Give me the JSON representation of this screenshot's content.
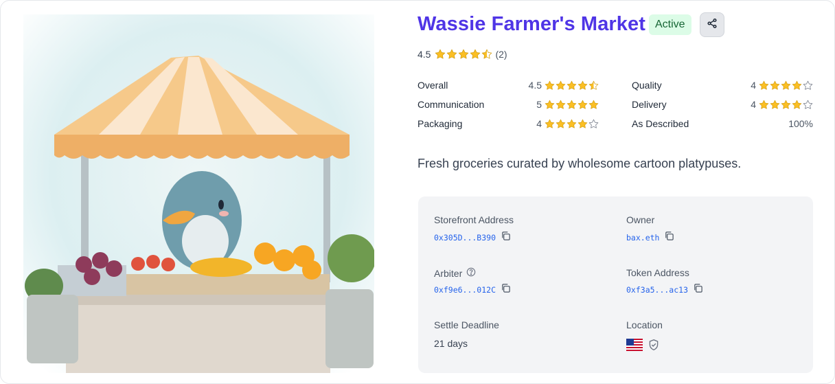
{
  "store": {
    "title": "Wassie Farmer's Market",
    "status": "Active",
    "description": "Fresh groceries curated by wholesome cartoon platypuses."
  },
  "summary": {
    "rating": "4.5",
    "stars": 4.5,
    "count": "(2)"
  },
  "ratings": [
    {
      "label": "Overall",
      "value": "4.5",
      "stars": 4.5
    },
    {
      "label": "Communication",
      "value": "5",
      "stars": 5
    },
    {
      "label": "Packaging",
      "value": "4",
      "stars": 4
    },
    {
      "label": "Quality",
      "value": "4",
      "stars": 4
    },
    {
      "label": "Delivery",
      "value": "4",
      "stars": 4
    },
    {
      "label": "As Described",
      "value": "100%"
    }
  ],
  "details": {
    "storefront_label": "Storefront Address",
    "storefront_value": "0x305D...B390",
    "owner_label": "Owner",
    "owner_value": "bax.eth",
    "arbiter_label": "Arbiter",
    "arbiter_value": "0xf9e6...012C",
    "token_label": "Token Address",
    "token_value": "0xf3a5...ac13",
    "deadline_label": "Settle Deadline",
    "deadline_value": "21 days",
    "location_label": "Location",
    "location_flag": "🇺🇸"
  },
  "icons": {
    "share": "share-icon",
    "copy": "copy-icon",
    "help": "help-circle-icon",
    "verified": "shield-check-icon",
    "star": "star-icon"
  },
  "colors": {
    "title": "#4f35e6",
    "star": "#fbbf24",
    "address": "#2563eb",
    "active_bg": "#dcfce7",
    "active_text": "#166534"
  }
}
